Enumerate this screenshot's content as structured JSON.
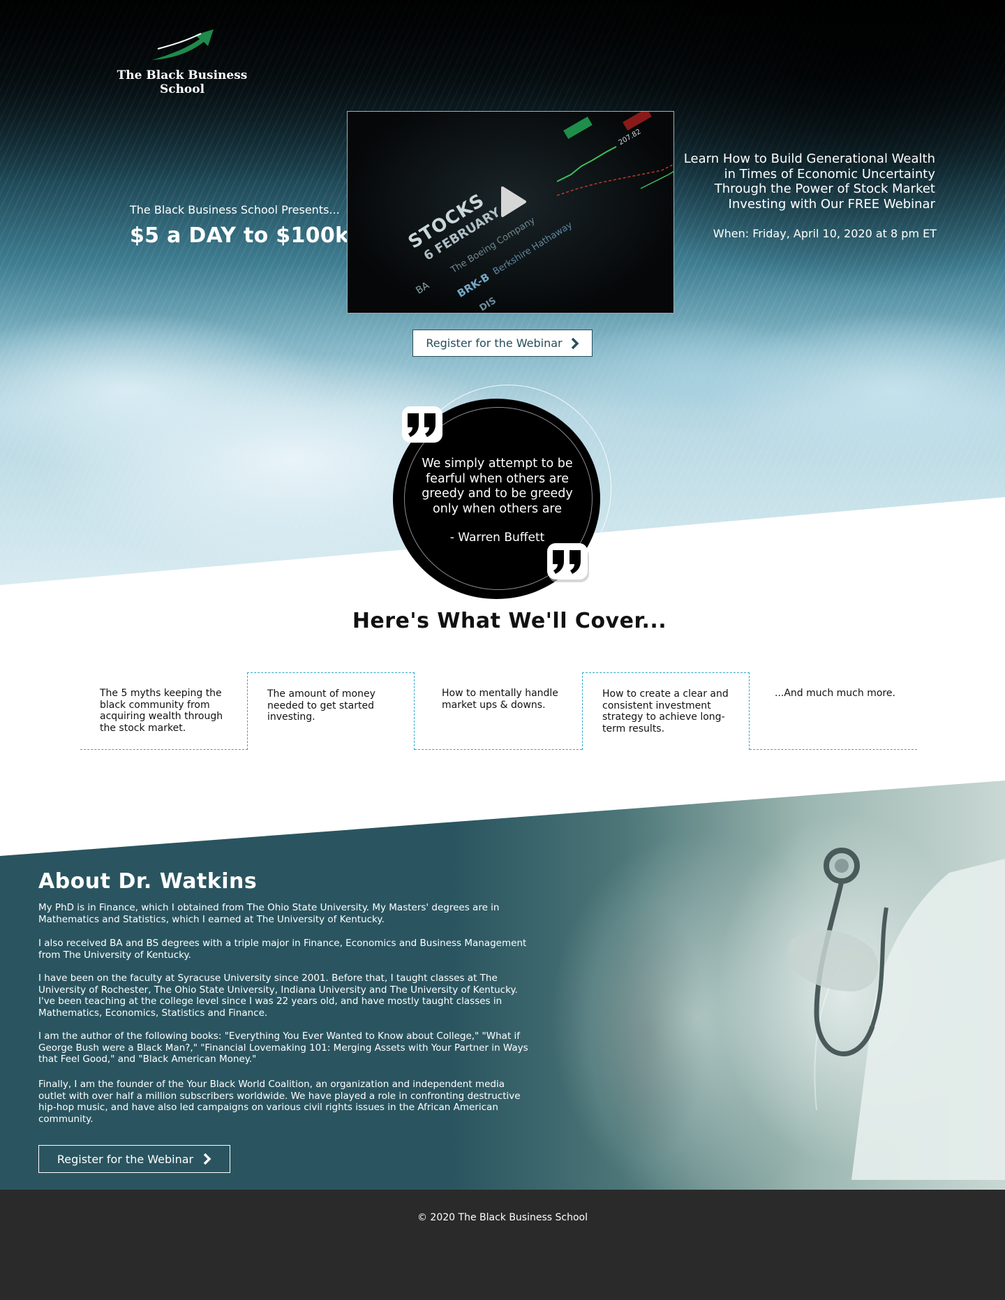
{
  "brand": {
    "name": "The Black Business School",
    "logo_icon": "rising-arrow-icon",
    "accent_color": "#1f8a4c"
  },
  "hero": {
    "presents": "The Black Business School Presents...",
    "headline": "$5 a DAY to $100k",
    "video": {
      "thumbnail_text": {
        "stocks": "STOCKS",
        "date": "6 FEBRUARY",
        "ba": "BA",
        "boeing": "The Boeing Company",
        "brk": "BRK-B",
        "berkshire": "Berkshire Hathaway",
        "dis": "DIS",
        "price": "207.82"
      },
      "play_icon": "play-icon"
    },
    "register_label": "Register for the Webinar",
    "description": "Learn How to Build Generational Wealth in Times of Economic Uncertainty Through the Power of Stock Market Investing with Our FREE Webinar",
    "when": "When: Friday, April 10, 2020 at 8 pm ET"
  },
  "quote": {
    "text": "We simply attempt to be fearful when others are greedy and to be greedy only when others are",
    "author": "- Warren Buffett",
    "icon": "quote-mark-icon"
  },
  "cover": {
    "title": "Here's What We'll Cover...",
    "items": [
      "The 5 myths keeping the black community from acquiring wealth through the stock market.",
      "The amount of money needed to get started investing.",
      "How to mentally handle market ups & downs.",
      "How to create a clear and consistent investment strategy to achieve long-term results.",
      "...And much much more."
    ],
    "border_color": "#2aa7c9"
  },
  "about": {
    "title": "About Dr. Watkins",
    "paragraphs": [
      "My PhD is in Finance, which I obtained from The Ohio State University. My Masters' degrees are in Mathematics and Statistics, which I earned at The University of Kentucky.",
      "I also received BA and BS degrees with a triple major in Finance, Economics and Business Management from The University of Kentucky.",
      "I have been on the faculty at Syracuse University since 2001. Before that, I taught classes at The University of Rochester, The Ohio State University, Indiana University and The University of Kentucky. I've been teaching at the college level since I was 22 years old, and have mostly taught classes in Mathematics, Economics, Statistics and Finance.",
      "I am the author of the following books: \"Everything You Ever Wanted to Know about College,\" \"What if George Bush were a Black Man?,\" \"Financial Lovemaking 101: Merging Assets with Your Partner in Ways that Feel Good,\" and \"Black American Money.\"",
      "Finally, I am the founder of the Your Black World Coalition, an organization and independent media outlet with over half a million subscribers worldwide. We have played a role in confronting destructive hip-hop music, and have also led campaigns on various civil rights issues in the African American community."
    ],
    "register_label": "Register for the Webinar",
    "background_color": "#2a5560"
  },
  "footer": {
    "text": "© 2020 The Black Business School"
  }
}
